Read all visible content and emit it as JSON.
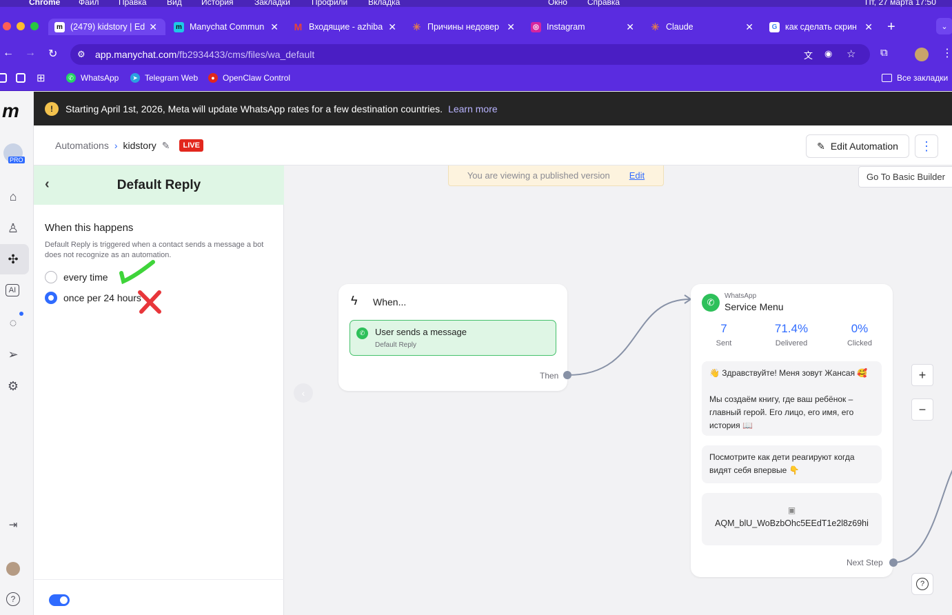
{
  "mac_menu": {
    "items": [
      "Chrome",
      "Файл",
      "Правка",
      "Вид",
      "История",
      "Закладки",
      "Профили",
      "Вкладка",
      "Окно",
      "Справка"
    ],
    "clock": "Пт, 27 марта 17:50"
  },
  "tabs": [
    {
      "title": "(2479) kidstory | Ed",
      "icon": "manychat-icon"
    },
    {
      "title": "Manychat Commun",
      "icon": "manychat-icon"
    },
    {
      "title": "Входящие - azhiba",
      "icon": "gmail-icon"
    },
    {
      "title": "Причины недовер",
      "icon": "claude-icon"
    },
    {
      "title": "Instagram",
      "icon": "instagram-icon"
    },
    {
      "title": "Claude",
      "icon": "claude-icon"
    },
    {
      "title": "как сделать скрин",
      "icon": "google-icon"
    }
  ],
  "address": {
    "host": "app.manychat.com",
    "path": "/fb2934433/cms/files/wa_default"
  },
  "bookmarks": [
    "WhatsApp",
    "Telegram Web",
    "OpenClaw Control"
  ],
  "all_bookmarks": "Все закладки",
  "banner": {
    "text": "Starting April 1st, 2026, Meta will update WhatsApp rates for a few destination countries.",
    "link": "Learn more"
  },
  "breadcrumb": {
    "root": "Automations",
    "current": "kidstory",
    "status": "LIVE"
  },
  "header": {
    "edit_label": "Edit Automation"
  },
  "panel": {
    "title": "Default Reply",
    "section": "When this happens",
    "description": "Default Reply is triggered when a contact sends a message a bot does not recognize as an automation.",
    "options": [
      {
        "label": "every time",
        "selected": false
      },
      {
        "label": "once per 24 hours",
        "selected": true
      }
    ],
    "toggle_on": true
  },
  "canvas": {
    "notice": "You are viewing a published version",
    "notice_link": "Edit",
    "basic_builder": "Go To Basic Builder",
    "when_card": {
      "title": "When...",
      "trigger": "User sends a message",
      "trigger_sub": "Default Reply",
      "then": "Then"
    },
    "service_card": {
      "channel": "WhatsApp",
      "title": "Service Menu",
      "stats": [
        {
          "value": "7",
          "label": "Sent"
        },
        {
          "value": "71.4%",
          "label": "Delivered"
        },
        {
          "value": "0%",
          "label": "Clicked"
        }
      ],
      "messages": [
        "👋 Здравствуйте! Меня зовут Жансая 🥰",
        "Мы создаём книгу, где ваш ребёнок – главный герой. Его лицо, его имя, его история 📖",
        "Посмотрите как дети реагируют когда видят себя впервые 👇"
      ],
      "video_name": "AQM_blU_WoBzbOhc5EEdT1e2l8z69hi",
      "next_step": "Next Step"
    },
    "zoom_in": "+",
    "zoom_out": "−",
    "help": "?"
  },
  "colors": {
    "browser": "#5a2ce0",
    "accent": "#2f6bff",
    "live": "#e2271d",
    "trigger_bg": "#dff6e5"
  }
}
